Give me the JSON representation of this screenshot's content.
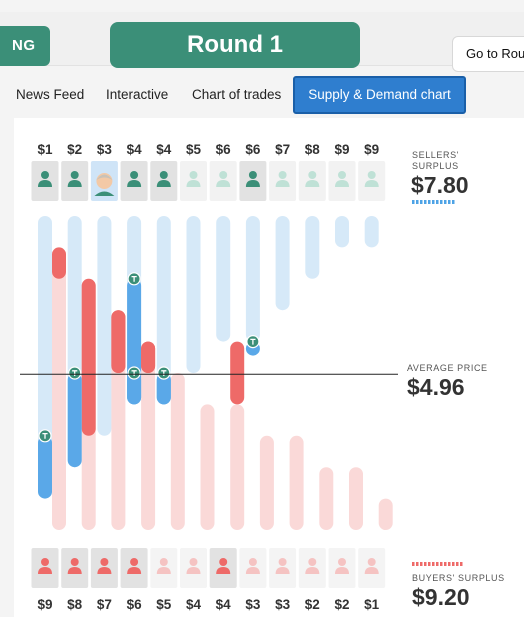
{
  "header": {
    "left_badge": "NG",
    "round_title": "Round 1",
    "goto_label": "Go to Rou"
  },
  "tabs": [
    {
      "label": "News Feed",
      "active": false
    },
    {
      "label": "Interactive",
      "active": false
    },
    {
      "label": "Chart of trades",
      "active": false
    },
    {
      "label": "Supply & Demand chart",
      "active": true
    }
  ],
  "sellers": {
    "label_line1": "SELLERS'",
    "label_line2": "SURPLUS",
    "surplus": "$7.80",
    "prices": [
      "$1",
      "$2",
      "$3",
      "$4",
      "$4",
      "$5",
      "$6",
      "$6",
      "$7",
      "$8",
      "$9",
      "$9"
    ],
    "traded": [
      true,
      true,
      true,
      true,
      true,
      false,
      false,
      true,
      false,
      false,
      false,
      false
    ],
    "you_index": 2
  },
  "buyers": {
    "label": "BUYERS' SURPLUS",
    "surplus": "$9.20",
    "prices": [
      "$9",
      "$8",
      "$7",
      "$6",
      "$5",
      "$4",
      "$4",
      "$3",
      "$3",
      "$2",
      "$2",
      "$1"
    ],
    "traded": [
      true,
      true,
      true,
      true,
      false,
      false,
      true,
      false,
      false,
      false,
      false,
      false
    ]
  },
  "average": {
    "label": "AVERAGE PRICE",
    "value": "$4.96"
  },
  "colors": {
    "accent_green": "#3b8f78",
    "tab_blue": "#2f7ecf",
    "seller_blue": "#5aa8e8",
    "seller_light": "#d6e9f8",
    "buyer_red": "#ee6a68",
    "buyer_light": "#fad9d8",
    "trade_marker": "#3b8f78"
  },
  "chart_data": {
    "type": "bar",
    "seller_costs": [
      1,
      2,
      3,
      4,
      4,
      5,
      6,
      6,
      7,
      8,
      9,
      9
    ],
    "buyer_values": [
      9,
      8,
      7,
      6,
      5,
      4,
      4,
      3,
      3,
      2,
      2,
      1
    ],
    "trades": [
      {
        "seller": 0,
        "buyer": 1,
        "price": 3.0
      },
      {
        "seller": 1,
        "buyer": 2,
        "price": 5.0
      },
      {
        "seller": 3,
        "buyer": 0,
        "price": 8.0
      },
      {
        "seller": 3,
        "buyer": 3,
        "price": 5.0
      },
      {
        "seller": 4,
        "buyer": 3,
        "price": 5.0
      },
      {
        "seller": 4,
        "buyer": 2,
        "price": 5.0
      },
      {
        "seller": 7,
        "buyer": 6,
        "price": 6.0
      }
    ],
    "average_price": 4.96,
    "ylim": [
      0,
      10
    ]
  }
}
